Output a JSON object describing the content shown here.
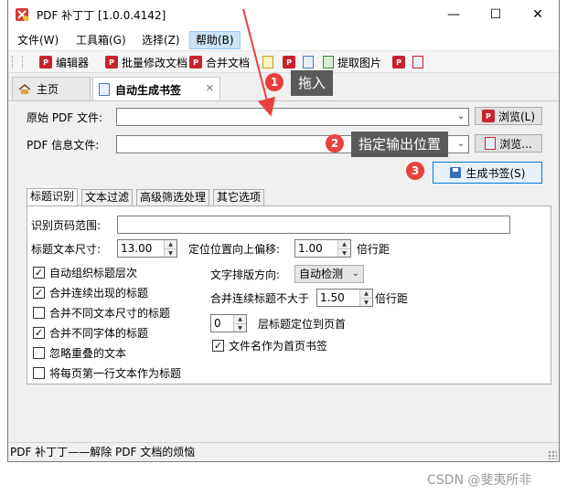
{
  "window": {
    "title": "PDF 补丁丁 [1.0.0.4142]"
  },
  "titlebar_buttons": {
    "minimize": "—",
    "maximize": "☐",
    "close": "✕"
  },
  "menu": [
    "文件(W)",
    "工具箱(G)",
    "选择(Z)",
    "帮助(B)"
  ],
  "toolbar": {
    "editor": "编辑器",
    "batch_modify": "批量修改文档",
    "merge": "合并文档",
    "extract_images": "提取图片"
  },
  "tabs": {
    "home": "主页",
    "auto_bookmark": "自动生成书签",
    "close": "✕"
  },
  "form": {
    "source_label": "原始 PDF 文件:",
    "info_label": "PDF 信息文件:",
    "browse": "浏览(L)",
    "browse2": "浏览...",
    "generate": "生成书签(S)"
  },
  "subtabs": [
    "标题识别",
    "文本过滤",
    "高级筛选处理",
    "其它选项"
  ],
  "recognition": {
    "page_range_label": "识别页码范围:",
    "font_size_label": "标题文本尺寸:",
    "font_size_value": "13.00",
    "offset_label": "定位位置向上偏移:",
    "offset_value": "1.00",
    "offset_unit": "倍行距",
    "direction_label": "文字排版方向:",
    "direction_value": "自动检测",
    "merge_label": "合并连续标题不大于",
    "merge_value": "1.50",
    "merge_unit": "倍行距",
    "level_value": "0",
    "level_label": "层标题定位到页首",
    "filename_label": "文件名作为首页书签"
  },
  "checkboxes_left": [
    {
      "label": "自动组织标题层次",
      "checked": "✓"
    },
    {
      "label": "合并连续出现的标题",
      "checked": "✓"
    },
    {
      "label": "合并不同文本尺寸的标题",
      "checked": ""
    },
    {
      "label": "合并不同字体的标题",
      "checked": "✓"
    },
    {
      "label": "忽略重叠的文本",
      "checked": ""
    },
    {
      "label": "将每页第一行文本作为标题",
      "checked": ""
    }
  ],
  "filename_checked": "✓",
  "status": "PDF 补丁丁——解除 PDF 文档的烦恼",
  "annotations": {
    "step1_num": "1",
    "step1_text": "拖入",
    "step2_num": "2",
    "step2_text": "指定输出位置",
    "step3_num": "3"
  },
  "watermark": "CSDN @斐夷所非",
  "colors": {
    "annotation_red": "#e8413d",
    "annotation_label": "#5a5a5a",
    "accent_blue": "#0078d7"
  }
}
